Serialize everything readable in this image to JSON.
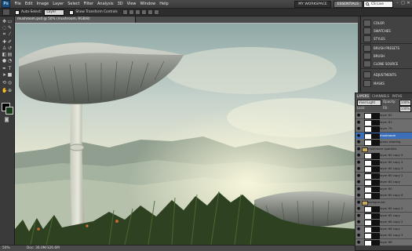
{
  "app": {
    "logo": "Ps"
  },
  "menu": [
    "File",
    "Edit",
    "Image",
    "Layer",
    "Select",
    "Filter",
    "Analysis",
    "3D",
    "View",
    "Window",
    "Help"
  ],
  "workspaces": {
    "my": "MY WORKSPACE",
    "essentials": "ESSENTIALS"
  },
  "search": {
    "placeholder": "CS Live"
  },
  "window_controls": [
    "–",
    "□",
    "✕"
  ],
  "options": {
    "auto_select_label": "Auto-Select:",
    "auto_select_value": "Layer",
    "transform_label": "Show Transform Controls"
  },
  "document": {
    "tab_title": "mushroom.psd @ 50% (mushroom, RGB/8)",
    "zoom": "50%",
    "doc_size": "Doc: 36.0M/326.6M"
  },
  "dock": [
    {
      "label": "COLOR",
      "icon": "color-icon"
    },
    {
      "label": "SWATCHES",
      "icon": "swatches-icon"
    },
    {
      "label": "STYLES",
      "icon": "styles-icon"
    },
    {
      "label": "BRUSH PRESETS",
      "icon": "brush-presets-icon"
    },
    {
      "label": "BRUSH",
      "icon": "brush-icon"
    },
    {
      "label": "CLONE SOURCE",
      "icon": "clone-source-icon"
    },
    {
      "label": "ADJUSTMENTS",
      "icon": "adjustments-icon"
    },
    {
      "label": "MASKS",
      "icon": "masks-icon"
    }
  ],
  "layers": {
    "tabs": [
      "LAYERS",
      "CHANNELS",
      "PATHS"
    ],
    "blend_mode": "Vivid Light",
    "opacity_label": "Opacity:",
    "opacity_value": "100%",
    "lock_label": "Lock:",
    "fill_label": "Fill:",
    "fill_value": "100%",
    "items": [
      {
        "name": "layer 82",
        "type": "layer",
        "selected": false
      },
      {
        "name": "layer 81",
        "type": "layer",
        "selected": false
      },
      {
        "name": "layer 79",
        "type": "layer",
        "selected": false
      },
      {
        "name": "mushroom",
        "type": "layer",
        "selected": true
      },
      {
        "name": "grass shading",
        "type": "layer",
        "selected": false
      },
      {
        "name": "mushroom sparkles",
        "type": "group",
        "selected": false
      },
      {
        "name": "layer 60 copy 5",
        "type": "layer",
        "selected": false
      },
      {
        "name": "layer 60 copy 4",
        "type": "layer",
        "selected": false
      },
      {
        "name": "layer 60 copy 3",
        "type": "layer",
        "selected": false
      },
      {
        "name": "layer 60 copy 2",
        "type": "layer",
        "selected": false
      },
      {
        "name": "layer 60 copy",
        "type": "layer",
        "selected": false
      },
      {
        "name": "layer 60",
        "type": "layer",
        "selected": false
      },
      {
        "name": "layer 60 copy 6",
        "type": "layer",
        "selected": false
      },
      {
        "name": "background",
        "type": "group",
        "selected": false
      },
      {
        "name": "layer 65 copy 2",
        "type": "layer",
        "selected": false
      },
      {
        "name": "layer 65 copy",
        "type": "layer",
        "selected": false
      },
      {
        "name": "layer 66 copy 2",
        "type": "layer",
        "selected": false
      },
      {
        "name": "layer 66 copy",
        "type": "layer",
        "selected": false
      },
      {
        "name": "layer 65 copy 3",
        "type": "layer",
        "selected": false
      },
      {
        "name": "layer 66",
        "type": "layer",
        "selected": false
      }
    ]
  },
  "colors": {
    "foreground": "#000000",
    "background": "#1b3a1c",
    "selection": "#3d6fb8"
  }
}
